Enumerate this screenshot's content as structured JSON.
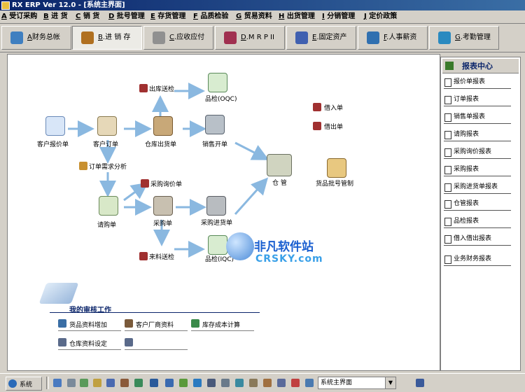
{
  "window": {
    "title": "RX ERP Ver 12.0 - [系统主界面]"
  },
  "menu": [
    {
      "key": "A",
      "label": "受订采购"
    },
    {
      "key": "B",
      "label": "进  货"
    },
    {
      "key": "C",
      "label": "销  货"
    },
    {
      "key": "D",
      "label": "批号管理"
    },
    {
      "key": "E",
      "label": "存货管理"
    },
    {
      "key": "F",
      "label": "品质检验"
    },
    {
      "key": "G",
      "label": "贸易资料"
    },
    {
      "key": "H",
      "label": "出货管理"
    },
    {
      "key": "I",
      "label": "分销管理"
    },
    {
      "key": "J",
      "label": "定价政策"
    }
  ],
  "modules": [
    {
      "key": "A",
      "label": "财务总帐",
      "color": "#3f7fc0"
    },
    {
      "key": "B",
      "label": "进 销 存",
      "color": "#b07020"
    },
    {
      "key": "C",
      "label": "应收应付",
      "color": "#909090"
    },
    {
      "key": "D",
      "label": "M R P II",
      "color": "#a03050"
    },
    {
      "key": "E",
      "label": "固定资产",
      "color": "#4060b0"
    },
    {
      "key": "F",
      "label": "人事薪资",
      "color": "#3070b0"
    },
    {
      "key": "G",
      "label": "考勤管理",
      "color": "#2a8ac0"
    }
  ],
  "flow": {
    "customer_quote": "客户报价单",
    "customer_order": "客户订单",
    "warehouse_delivery": "仓库出货单",
    "sales_invoice": "销售开单",
    "outbound_inspection": "出库送检",
    "oqc_inspection": "品检(OQC)",
    "order_demand_analysis": "订单需求分析",
    "requisition": "请购单",
    "purchase_inquiry": "采购询价单",
    "purchase_order": "采购单",
    "purchase_receipt": "采购进货单",
    "incoming_inspection": "来料送检",
    "iqc_inspection": "品检(IQC)",
    "warehouse": "仓  管",
    "borrow_in": "借入单",
    "borrow_out": "借出单",
    "batch_control": "货品批号管制"
  },
  "watermark": {
    "line1": "非凡软件站",
    "line2": "CRSKY.com"
  },
  "audit": {
    "title": "我的审核工作",
    "items": [
      "货品资料增加",
      "客户厂商资料",
      "库存成本计算",
      "仓库资料设定",
      ""
    ]
  },
  "sidebar": {
    "title": "报表中心",
    "items": [
      "报价单报表",
      "订单报表",
      "销售单报表",
      "请购报表",
      "采购询价报表",
      "采购报表",
      "采购进货单报表",
      "仓管报表",
      "品检报表",
      "借入借出报表",
      "业务财务报表"
    ]
  },
  "statusbar": {
    "system_label": "系统",
    "combo_value": "系统主界面"
  }
}
